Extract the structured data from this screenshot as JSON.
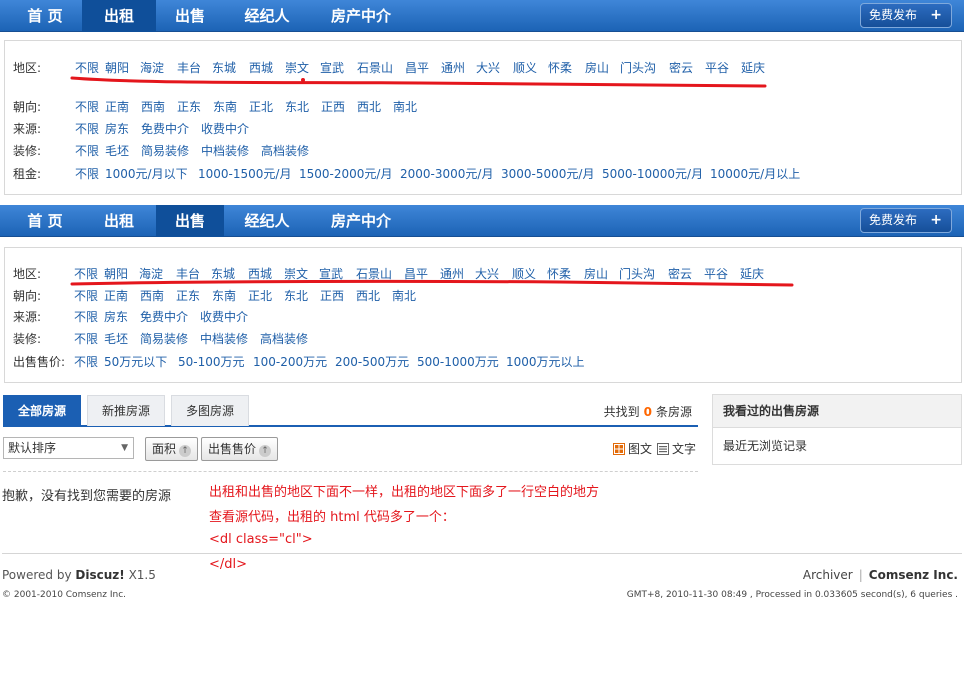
{
  "nav": {
    "items": [
      "首 页",
      "出租",
      "出售",
      "经纪人",
      "房产中介"
    ],
    "publish_label": "免费发布",
    "publish_icon": "plus-icon"
  },
  "rent_filters": {
    "region_label": "地区:",
    "regions": [
      "不限",
      "朝阳",
      "海淀",
      "丰台",
      "东城",
      "西城",
      "崇文",
      "宣武",
      "石景山",
      "昌平",
      "通州",
      "大兴",
      "顺义",
      "怀柔",
      "房山",
      "门头沟",
      "密云",
      "平谷",
      "延庆"
    ],
    "orientation_label": "朝向:",
    "orientations": [
      "不限",
      "正南",
      "西南",
      "正东",
      "东南",
      "正北",
      "东北",
      "正西",
      "西北",
      "南北"
    ],
    "source_label": "来源:",
    "sources": [
      "不限",
      "房东",
      "免费中介",
      "收费中介"
    ],
    "decoration_label": "装修:",
    "decorations": [
      "不限",
      "毛坯",
      "简易装修",
      "中档装修",
      "高档装修"
    ],
    "price_label": "租金:",
    "prices": [
      "不限",
      "1000元/月以下",
      "1000-1500元/月",
      "1500-2000元/月",
      "2000-3000元/月",
      "3000-5000元/月",
      "5000-10000元/月",
      "10000元/月以上"
    ]
  },
  "sale_filters": {
    "region_label": "地区:",
    "regions": [
      "不限",
      "朝阳",
      "海淀",
      "丰台",
      "东城",
      "西城",
      "崇文",
      "宣武",
      "石景山",
      "昌平",
      "通州",
      "大兴",
      "顺义",
      "怀柔",
      "房山",
      "门头沟",
      "密云",
      "平谷",
      "延庆"
    ],
    "orientation_label": "朝向:",
    "orientations": [
      "不限",
      "正南",
      "西南",
      "正东",
      "东南",
      "正北",
      "东北",
      "正西",
      "西北",
      "南北"
    ],
    "source_label": "来源:",
    "sources": [
      "不限",
      "房东",
      "免费中介",
      "收费中介"
    ],
    "decoration_label": "装修:",
    "decorations": [
      "不限",
      "毛坯",
      "简易装修",
      "中档装修",
      "高档装修"
    ],
    "price_label": "出售售价:",
    "prices": [
      "不限",
      "50万元以下",
      "50-100万元",
      "100-200万元",
      "200-500万元",
      "500-1000万元",
      "1000万元以上"
    ]
  },
  "tabs": [
    "全部房源",
    "新推房源",
    "多图房源"
  ],
  "results": {
    "prefix": "共找到",
    "count": "0",
    "suffix": "条房源"
  },
  "sort": {
    "selected": "默认排序",
    "area_label": "面积",
    "price_label": "出售售价"
  },
  "view": {
    "pic_label": "图文",
    "text_label": "文字",
    "pic_icon": "grid-icon",
    "text_icon": "list-icon"
  },
  "empty_message": "抱歉，没有找到您需要的房源",
  "annotation": {
    "line1": "出租和出售的地区下面不一样，出租的地区下面多了一行空白的地方",
    "line2": "查看源代码，出租的 html 代码多了一个：",
    "line3": "<dl class=\"cl\">",
    "line4": "</dl>"
  },
  "sidebar": {
    "title": "我看过的出售房源",
    "empty_text": "最近无浏览记录"
  },
  "footer": {
    "powered_prefix": "Powered by",
    "powered_brand": "Discuz!",
    "powered_version": "X1.5",
    "copyright": "© 2001-2010 Comsenz Inc.",
    "archiver": "Archiver",
    "company": "Comsenz Inc.",
    "gmt": "GMT+8, 2010-11-30 08:49 , Processed in 0.033605 second(s), 6 queries ."
  },
  "colors": {
    "nav_blue": "#1c63b5",
    "link": "#1f5fa8",
    "annotation_red": "#e4161c",
    "count_orange": "#ff6600"
  }
}
